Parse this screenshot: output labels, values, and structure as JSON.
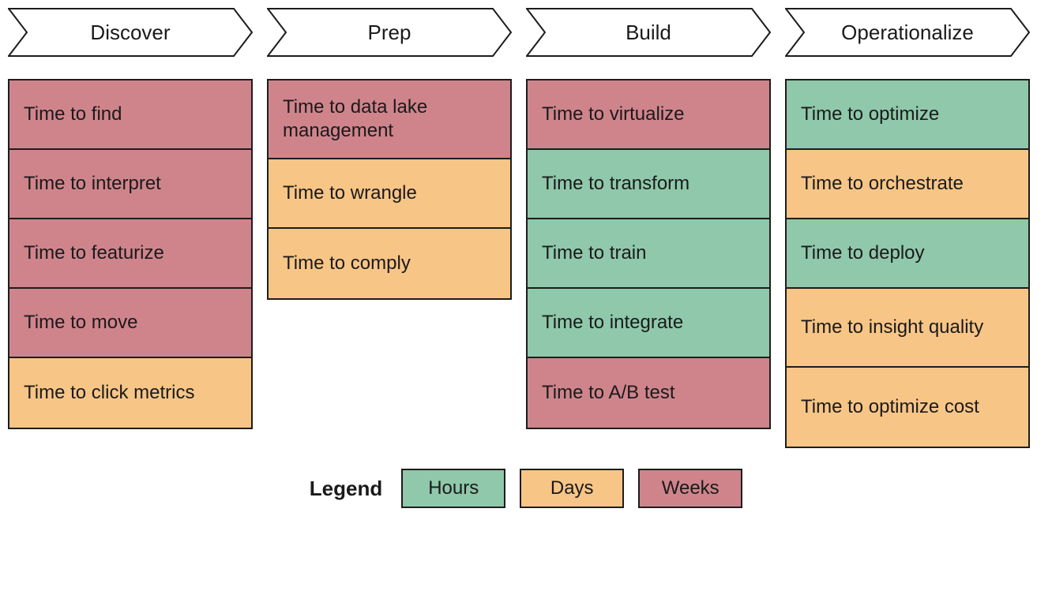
{
  "phases": [
    {
      "name": "Discover"
    },
    {
      "name": "Prep"
    },
    {
      "name": "Build"
    },
    {
      "name": "Operationalize"
    }
  ],
  "columns": {
    "discover": [
      {
        "label": "Time to find",
        "level": "weeks"
      },
      {
        "label": "Time to interpret",
        "level": "weeks"
      },
      {
        "label": "Time to featurize",
        "level": "weeks"
      },
      {
        "label": "Time to move",
        "level": "weeks"
      },
      {
        "label": "Time to click metrics",
        "level": "days"
      }
    ],
    "prep": [
      {
        "label": "Time to data lake management",
        "level": "weeks",
        "tall": true
      },
      {
        "label": "Time to wrangle",
        "level": "days"
      },
      {
        "label": "Time to comply",
        "level": "days"
      }
    ],
    "build": [
      {
        "label": "Time to virtualize",
        "level": "weeks"
      },
      {
        "label": "Time to transform",
        "level": "hours"
      },
      {
        "label": "Time to train",
        "level": "hours"
      },
      {
        "label": "Time to integrate",
        "level": "hours"
      },
      {
        "label": "Time to A/B test",
        "level": "weeks"
      }
    ],
    "operationalize": [
      {
        "label": "Time to optimize",
        "level": "hours"
      },
      {
        "label": "Time to orchestrate",
        "level": "days"
      },
      {
        "label": "Time to deploy",
        "level": "hours"
      },
      {
        "label": "Time to insight quality",
        "level": "days",
        "tall": true
      },
      {
        "label": "Time to optimize cost",
        "level": "days",
        "tall": true
      }
    ]
  },
  "legend": {
    "title": "Legend",
    "items": [
      {
        "label": "Hours",
        "level": "hours"
      },
      {
        "label": "Days",
        "level": "days"
      },
      {
        "label": "Weeks",
        "level": "weeks"
      }
    ]
  },
  "colors": {
    "hours": "#8fc8aa",
    "days": "#f7c586",
    "weeks": "#cf848c",
    "stroke": "#1d1d1b"
  }
}
